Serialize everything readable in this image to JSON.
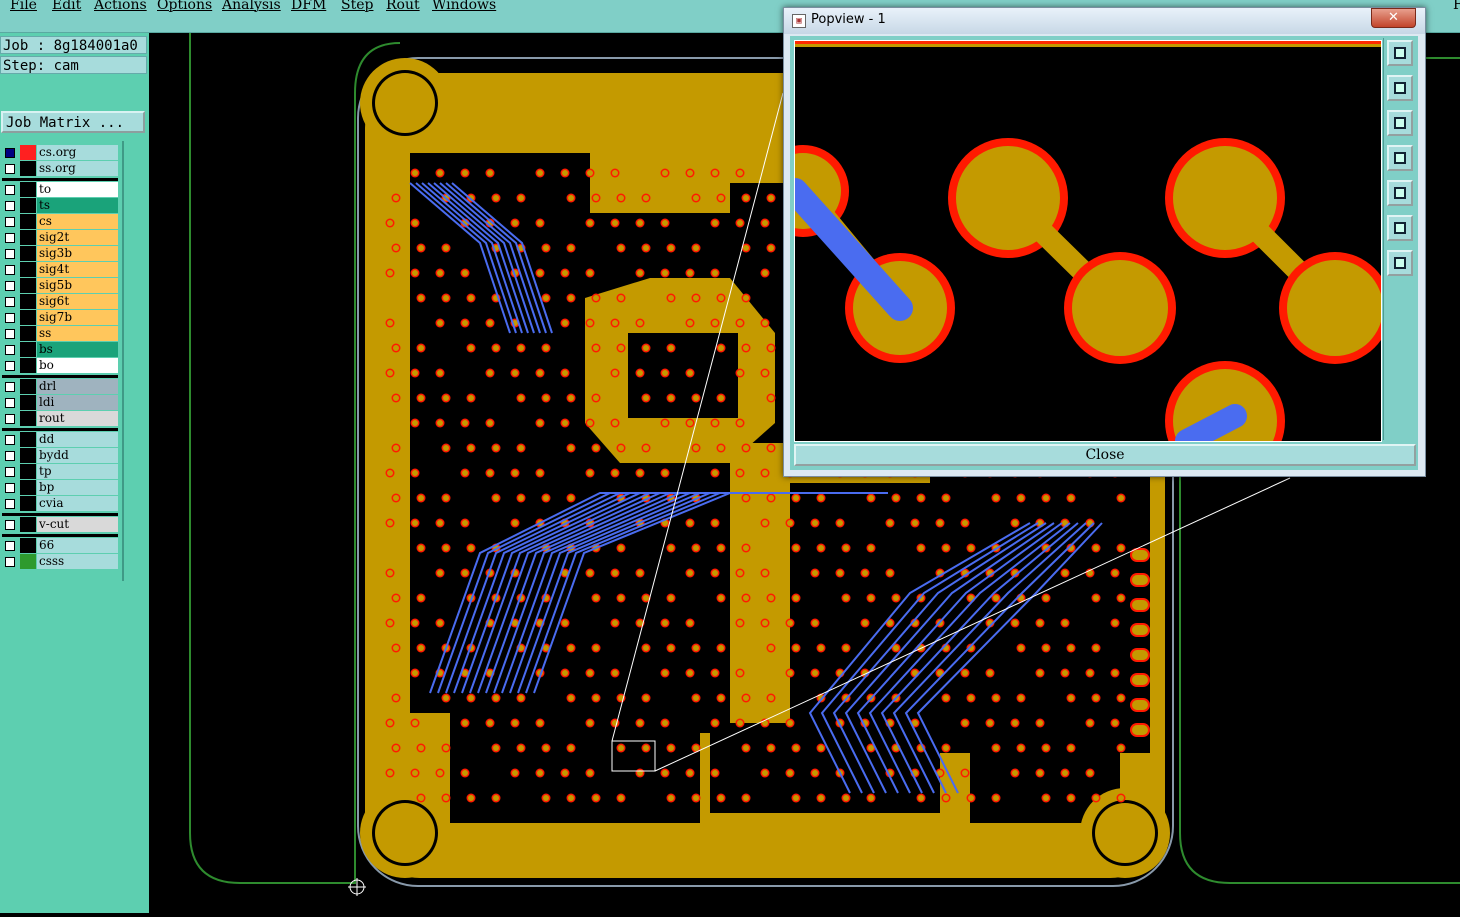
{
  "menu": {
    "items": [
      "File",
      "Edit",
      "Actions",
      "Options",
      "Analysis",
      "DFM",
      "Step",
      "Rout",
      "Windows"
    ],
    "trailing": "F"
  },
  "job": {
    "job_line": "Job : 8g184001a0",
    "step_line": "Step: cam",
    "matrix_button": "Job Matrix ..."
  },
  "layers": [
    {
      "name": "cs.org",
      "color": "#a7dcdc",
      "swatch": "#000000"
    },
    {
      "name": "ss.org",
      "color": "#a7dcdc",
      "swatch": "#000000"
    },
    {
      "name": "to",
      "color": "#ffffff",
      "swatch": "#000000"
    },
    {
      "name": "ts",
      "color": "#1aa37a",
      "swatch": "#000000"
    },
    {
      "name": "cs",
      "color": "#ffc65c",
      "swatch": "#000000"
    },
    {
      "name": "sig2t",
      "color": "#ffc65c",
      "swatch": "#000000"
    },
    {
      "name": "sig3b",
      "color": "#ffc65c",
      "swatch": "#000000"
    },
    {
      "name": "sig4t",
      "color": "#ffc65c",
      "swatch": "#000000"
    },
    {
      "name": "sig5b",
      "color": "#ffc65c",
      "swatch": "#000000"
    },
    {
      "name": "sig6t",
      "color": "#ffc65c",
      "swatch": "#000000"
    },
    {
      "name": "sig7b",
      "color": "#ffc65c",
      "swatch": "#000000"
    },
    {
      "name": "ss",
      "color": "#ffc65c",
      "swatch": "#000000"
    },
    {
      "name": "bs",
      "color": "#1aa37a",
      "swatch": "#000000"
    },
    {
      "name": "bo",
      "color": "#ffffff",
      "swatch": "#000000"
    },
    {
      "name": "drl",
      "color": "#9fb3bf",
      "swatch": "#000000"
    },
    {
      "name": "ldi",
      "color": "#9fb3bf",
      "swatch": "#000000"
    },
    {
      "name": "rout",
      "color": "#d9d9d9",
      "swatch": "#000000"
    },
    {
      "name": "dd",
      "color": "#a7dcdc",
      "swatch": "#000000"
    },
    {
      "name": "bydd",
      "color": "#a7dcdc",
      "swatch": "#000000"
    },
    {
      "name": "tp",
      "color": "#a7dcdc",
      "swatch": "#000000"
    },
    {
      "name": "bp",
      "color": "#a7dcdc",
      "swatch": "#000000"
    },
    {
      "name": "cvia",
      "color": "#a7dcdc",
      "swatch": "#000000"
    },
    {
      "name": "v-cut",
      "color": "#d9d9d9",
      "swatch": "#000000"
    },
    {
      "name": "66",
      "color": "#a7dcdc",
      "swatch": "#000000"
    },
    {
      "name": "csss",
      "color": "#a7dcdc",
      "swatch": "#2e9a2e"
    }
  ],
  "popview": {
    "title": "Popview - 1",
    "close_x": "✕",
    "close_button": "Close",
    "tools": [
      "zoom-window-icon",
      "pan-up-icon",
      "pan-down-icon",
      "pan-left-icon",
      "pan-right-icon",
      "zoom-fit-icon",
      "zoom-home-icon"
    ]
  },
  "colors": {
    "copper": "#c49a00",
    "pad_outline": "#ff1a00",
    "trace_blue": "#4a6cf0",
    "outline_green": "#2e8b2e",
    "panel_bg": "#5dcfb0",
    "menu_bg": "#80cfc7"
  }
}
